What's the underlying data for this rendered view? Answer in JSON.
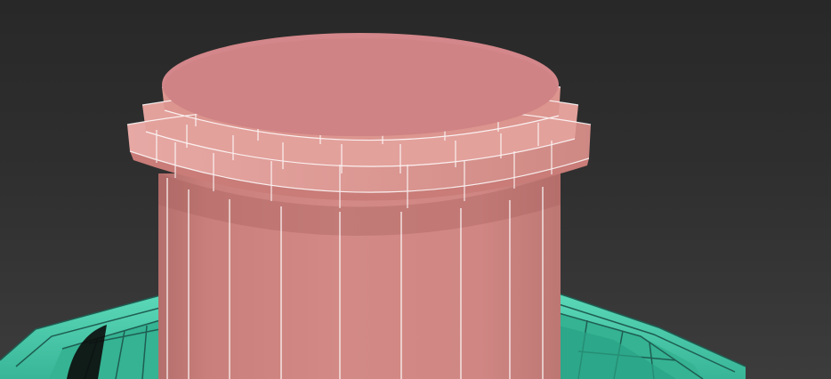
{
  "viewport": {
    "label": "",
    "background_top": "#282828",
    "background_bottom": "#3c3c3c"
  },
  "scene": {
    "objects": [
      {
        "name": "cylinder-column",
        "color": "#d38a86",
        "display": "edged-faces",
        "edge_color": "#ffffff"
      },
      {
        "name": "stepped-base",
        "color": "#40c6a6",
        "display": "wireframe-overlay",
        "edge_color": "#1e5e52"
      }
    ]
  }
}
